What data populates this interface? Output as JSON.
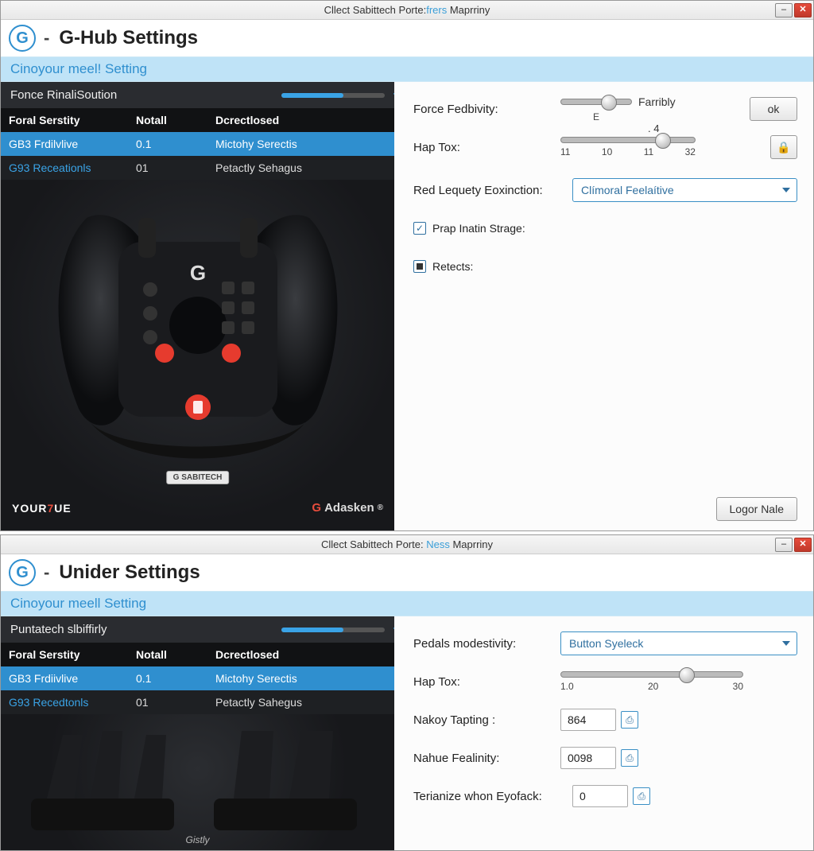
{
  "window1": {
    "title_pre": "Cllect Sabittech Porte:",
    "title_em": "frers",
    "title_post": " Maprriny",
    "header": "G-Hub Settings",
    "subheader": "Cinoyour meel! Setting",
    "section_bar": "Fonce RinaliSoution",
    "table": {
      "headers": [
        "Foral Serstity",
        "Notall",
        "Dcrectlosed"
      ],
      "rows": [
        {
          "c1": "GB3 Frdilvlive",
          "c2": "0.1",
          "c3": "Mictohy Serectis"
        },
        {
          "c1": "G93 Receationls",
          "c2": "01",
          "c3": "Petactly Sehagus"
        }
      ]
    },
    "watermark_left_pre": "YOUR",
    "watermark_left_accent": "7",
    "watermark_left_post": "UE",
    "watermark_right": "Adasken",
    "plaque": "G SABITECH",
    "form": {
      "force_label": "Force Fedbivity:",
      "force_text": "Farribly",
      "force_tick": "E",
      "ok": "ok",
      "hap_label": "Hap Tox:",
      "hap_value": ". 4",
      "hap_ticks": [
        "11",
        "10",
        "11",
        "32"
      ],
      "led_label": "Red Lequety Eoxinction:",
      "led_select": "Clímoral Feelaítive",
      "chk1_label": "Prap Inatin Strage:",
      "chk2_label": "Retects:",
      "footer": "Logor Nale"
    }
  },
  "window2": {
    "title_pre": "Cllect Sabittech Porte: ",
    "title_em": "Ness",
    "title_post": " Maprriny",
    "header": "Unider Settings",
    "subheader": "Cinoyour meell Setting",
    "section_bar": "Puntatech slbiffirly",
    "table": {
      "headers": [
        "Foral Serstity",
        "Notall",
        "Dcrectlosed"
      ],
      "rows": [
        {
          "c1": "GB3 Frdiivlive",
          "c2": "0.1",
          "c3": "Mictohy Serectis"
        },
        {
          "c1": "G93 Recedtonls",
          "c2": "01",
          "c3": "Petactly Sahegus"
        }
      ]
    },
    "watermark_center": "Gistly",
    "form": {
      "pedals_label": "Pedals modestivity:",
      "pedals_select": "Button Syeleck",
      "hap_label": "Hap Tox:",
      "hap_ticks": [
        "1.0",
        "20",
        "30"
      ],
      "num1_label": "Nakoy Tapting :",
      "num1_value": "864",
      "num2_label": "Nahue Fealinity:",
      "num2_value": "0098",
      "num3_label": "Terianize whon Eyofack:",
      "num3_value": "0"
    }
  }
}
